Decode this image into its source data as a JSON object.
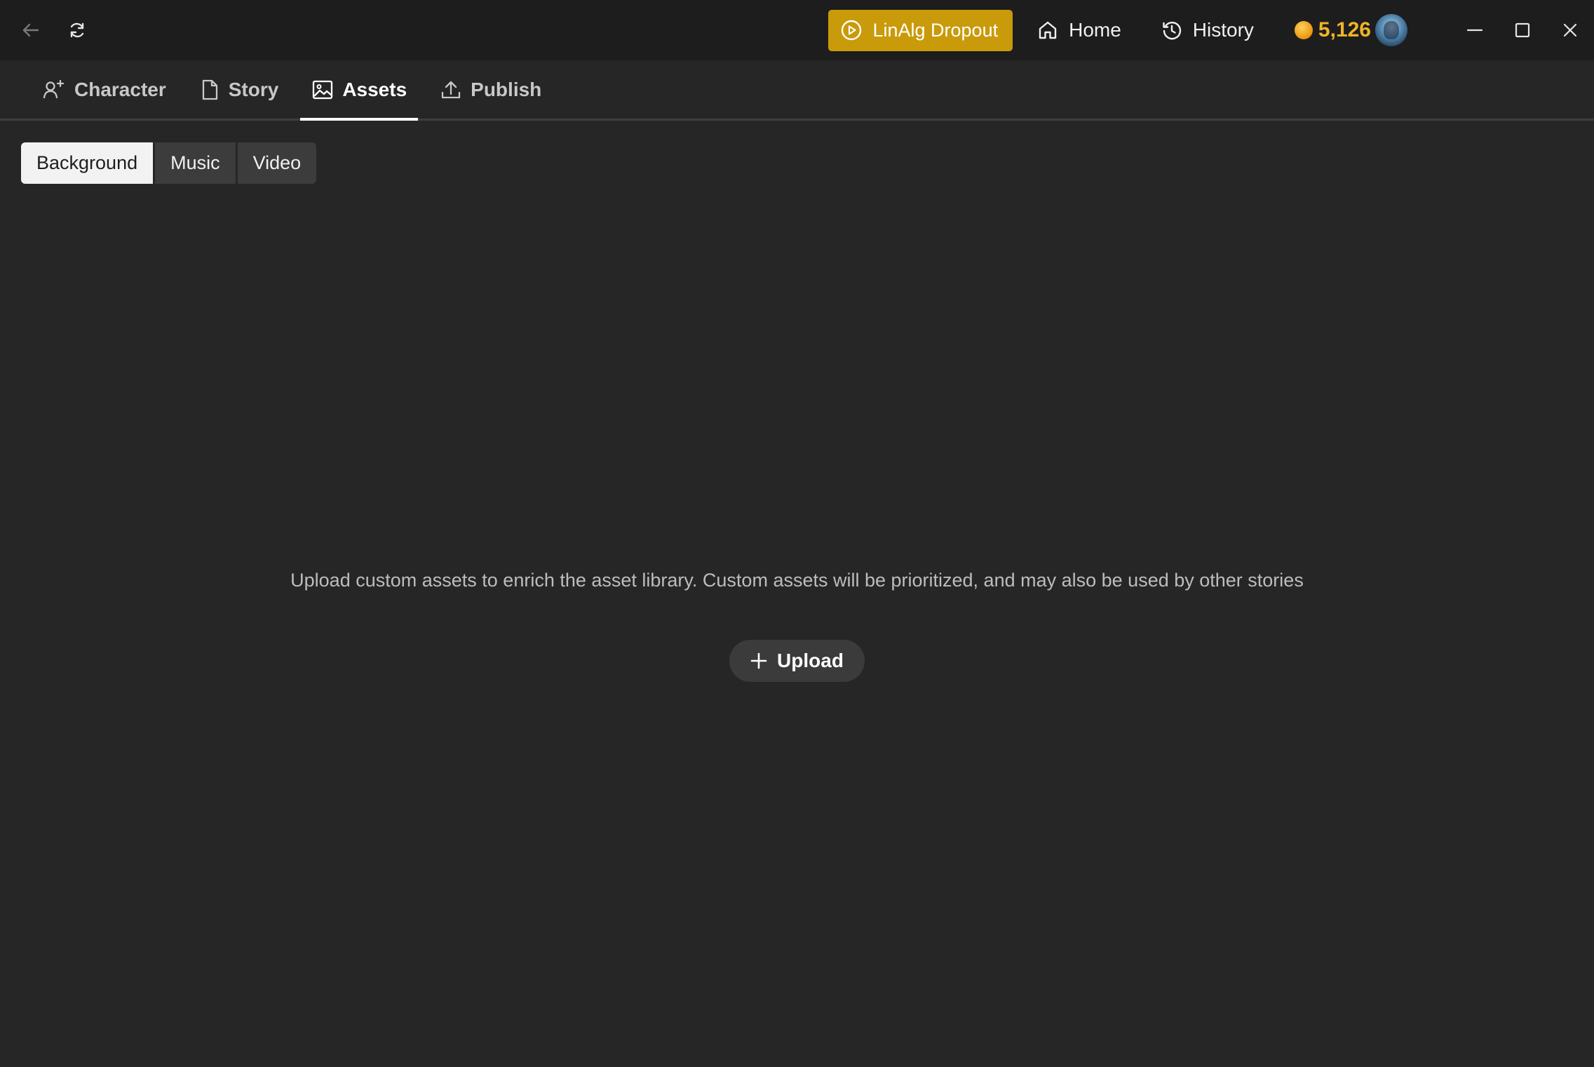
{
  "titlebar": {
    "story_name": "LinAlg Dropout",
    "home_label": "Home",
    "history_label": "History",
    "coin_balance": "5,126"
  },
  "main_tabs": [
    {
      "label": "Character",
      "icon": "user-add-icon"
    },
    {
      "label": "Story",
      "icon": "document-icon"
    },
    {
      "label": "Assets",
      "icon": "image-icon",
      "active": true
    },
    {
      "label": "Publish",
      "icon": "upload-icon"
    }
  ],
  "sub_tabs": [
    {
      "label": "Background",
      "active": true
    },
    {
      "label": "Music"
    },
    {
      "label": "Video"
    }
  ],
  "empty_state": {
    "message": "Upload custom assets to enrich the asset library. Custom assets will be prioritized, and may also be used by other stories",
    "upload_label": "Upload"
  },
  "colors": {
    "background": "#262626",
    "titlebar": "#1d1d1d",
    "accent_gold": "#c99a0a",
    "coin_text": "#f0b429"
  }
}
